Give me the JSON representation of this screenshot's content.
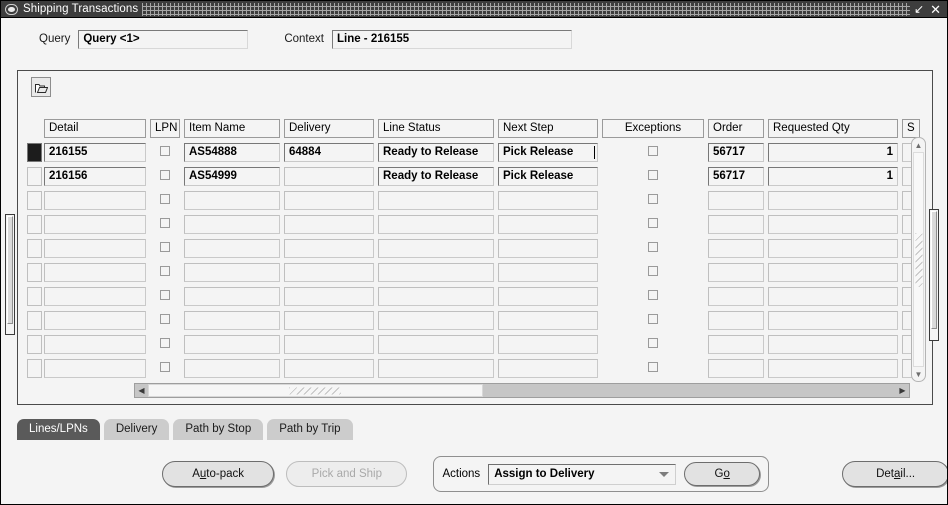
{
  "window": {
    "title": "Shipping Transactions",
    "icon": "window-menu-icon",
    "restore_label": "↙",
    "close_label": "✕"
  },
  "header": {
    "query_label": "Query",
    "query_value": "Query <1>",
    "context_label": "Context",
    "context_value": "Line - 216155"
  },
  "toolbar": {
    "open_icon": "open-folder-icon"
  },
  "grid": {
    "columns": [
      {
        "key": "detail",
        "label": "Detail",
        "align": "left"
      },
      {
        "key": "lpn",
        "label": "LPN",
        "align": "center"
      },
      {
        "key": "item_name",
        "label": "Item Name",
        "align": "left"
      },
      {
        "key": "delivery",
        "label": "Delivery",
        "align": "left"
      },
      {
        "key": "line_status",
        "label": "Line Status",
        "align": "left"
      },
      {
        "key": "next_step",
        "label": "Next Step",
        "align": "left"
      },
      {
        "key": "exceptions",
        "label": "Exceptions",
        "align": "center"
      },
      {
        "key": "order",
        "label": "Order",
        "align": "left"
      },
      {
        "key": "requested_qty",
        "label": "Requested Qty",
        "align": "right"
      },
      {
        "key": "s",
        "label": "S",
        "align": "left"
      }
    ],
    "rows": [
      {
        "selected": true,
        "detail": "216155",
        "lpn": "",
        "item_name": "AS54888",
        "delivery": "64884",
        "line_status": "Ready to Release",
        "next_step": "Pick Release",
        "next_step_caret": true,
        "exceptions": "",
        "order": "56717",
        "requested_qty": "1",
        "s": ""
      },
      {
        "selected": false,
        "detail": "216156",
        "lpn": "",
        "item_name": "AS54999",
        "delivery": "",
        "line_status": "Ready to Release",
        "next_step": "Pick Release",
        "next_step_caret": false,
        "exceptions": "",
        "order": "56717",
        "requested_qty": "1",
        "s": ""
      },
      {
        "selected": false,
        "detail": "",
        "lpn": "",
        "item_name": "",
        "delivery": "",
        "line_status": "",
        "next_step": "",
        "exceptions": "",
        "order": "",
        "requested_qty": "",
        "s": ""
      },
      {
        "selected": false,
        "detail": "",
        "lpn": "",
        "item_name": "",
        "delivery": "",
        "line_status": "",
        "next_step": "",
        "exceptions": "",
        "order": "",
        "requested_qty": "",
        "s": ""
      },
      {
        "selected": false,
        "detail": "",
        "lpn": "",
        "item_name": "",
        "delivery": "",
        "line_status": "",
        "next_step": "",
        "exceptions": "",
        "order": "",
        "requested_qty": "",
        "s": ""
      },
      {
        "selected": false,
        "detail": "",
        "lpn": "",
        "item_name": "",
        "delivery": "",
        "line_status": "",
        "next_step": "",
        "exceptions": "",
        "order": "",
        "requested_qty": "",
        "s": ""
      },
      {
        "selected": false,
        "detail": "",
        "lpn": "",
        "item_name": "",
        "delivery": "",
        "line_status": "",
        "next_step": "",
        "exceptions": "",
        "order": "",
        "requested_qty": "",
        "s": ""
      },
      {
        "selected": false,
        "detail": "",
        "lpn": "",
        "item_name": "",
        "delivery": "",
        "line_status": "",
        "next_step": "",
        "exceptions": "",
        "order": "",
        "requested_qty": "",
        "s": ""
      },
      {
        "selected": false,
        "detail": "",
        "lpn": "",
        "item_name": "",
        "delivery": "",
        "line_status": "",
        "next_step": "",
        "exceptions": "",
        "order": "",
        "requested_qty": "",
        "s": ""
      },
      {
        "selected": false,
        "detail": "",
        "lpn": "",
        "item_name": "",
        "delivery": "",
        "line_status": "",
        "next_step": "",
        "exceptions": "",
        "order": "",
        "requested_qty": "",
        "s": ""
      }
    ]
  },
  "scrollbars": {
    "up_arrow": "▲",
    "down_arrow": "▼",
    "left_arrow": "◀",
    "right_arrow": "▶"
  },
  "tabs": [
    {
      "label": "Lines/LPNs",
      "active": true
    },
    {
      "label": "Delivery",
      "active": false
    },
    {
      "label": "Path by Stop",
      "active": false
    },
    {
      "label": "Path by Trip",
      "active": false
    }
  ],
  "buttons": {
    "auto_pack": {
      "pre": "A",
      "mnemonic": "u",
      "post": "to-pack",
      "disabled": false
    },
    "pick_and_ship": {
      "label": "Pick and Ship",
      "disabled": true
    },
    "go": {
      "pre": "G",
      "mnemonic": "o",
      "post": "",
      "disabled": false
    },
    "detail": {
      "pre": "Det",
      "mnemonic": "a",
      "post": "il...",
      "disabled": false
    }
  },
  "actions": {
    "label": "Actions",
    "selected": "Assign to Delivery"
  },
  "colors": {
    "titlebar_bg": "#3d3d3d",
    "window_bg": "#f4f4f4",
    "active_tab_bg": "#5a5a5a",
    "tab_bg": "#cccccc",
    "selector_active": "#1c1c1c"
  }
}
